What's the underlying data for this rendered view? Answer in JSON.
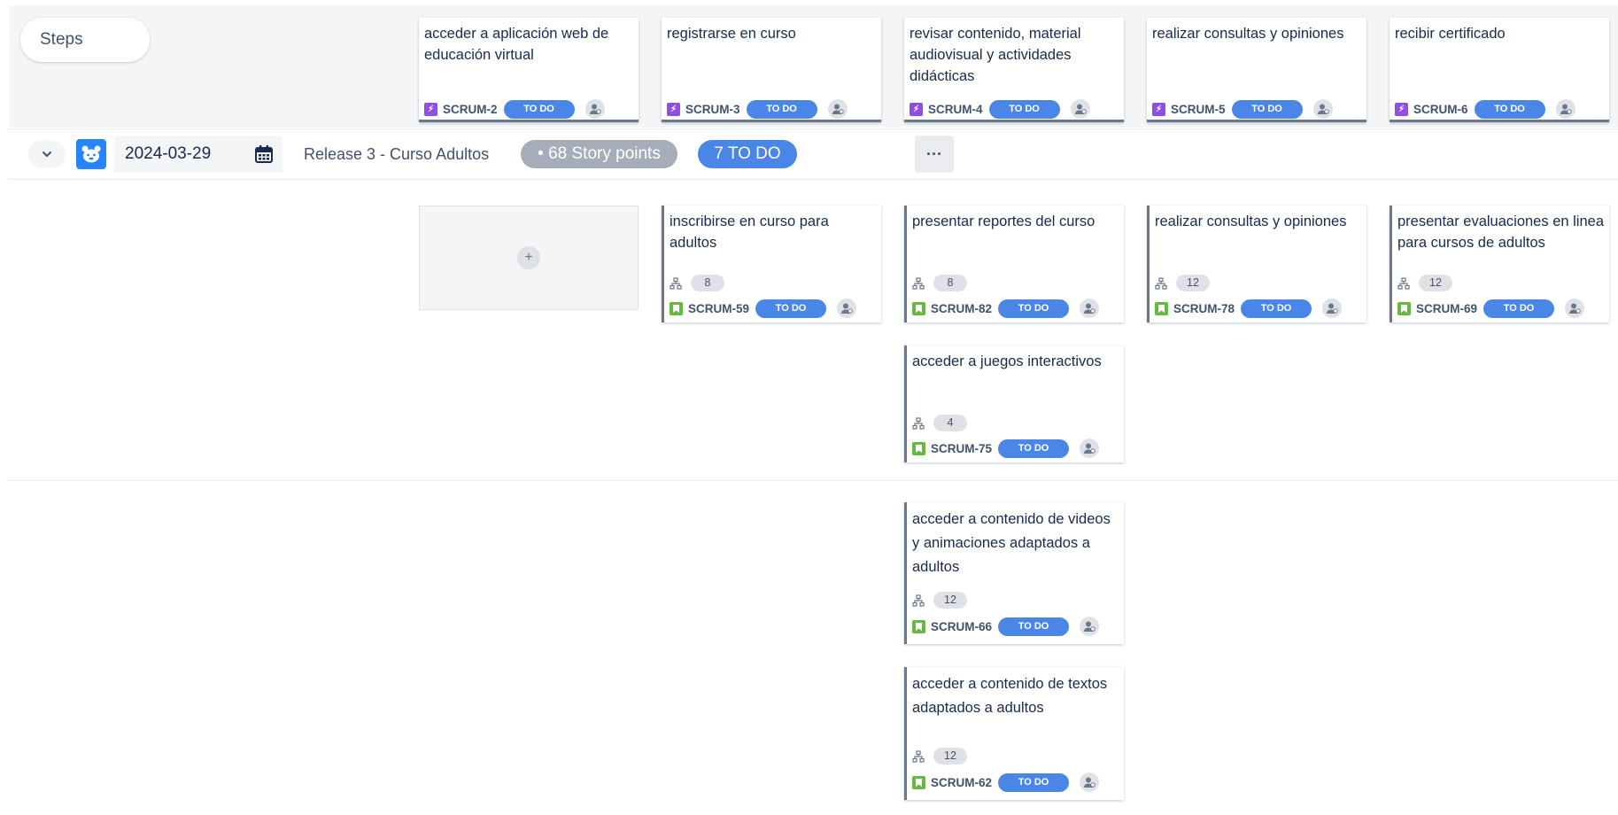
{
  "steps_label": "Steps",
  "epics": [
    {
      "title": "acceder a aplicación web de educación virtual",
      "key": "SCRUM-2",
      "status": "TO DO"
    },
    {
      "title": "registrarse en curso",
      "key": "SCRUM-3",
      "status": "TO DO"
    },
    {
      "title": "revisar contenido, material audiovisual y actividades didácticas",
      "key": "SCRUM-4",
      "status": "TO DO"
    },
    {
      "title": "realizar consultas y opiniones",
      "key": "SCRUM-5",
      "status": "TO DO"
    },
    {
      "title": "recibir certificado",
      "key": "SCRUM-6",
      "status": "TO DO"
    }
  ],
  "release": {
    "date": "2024-03-29",
    "name": "Release 3 - Curso Adultos",
    "story_points": "• 68 Story points",
    "todo": "7 TO DO",
    "more": "···"
  },
  "add_symbol": "+",
  "stories": [
    {
      "title": "inscribirse en curso para adultos",
      "points": "8",
      "key": "SCRUM-59",
      "status": "TO DO"
    },
    {
      "title": "presentar reportes del curso",
      "points": "8",
      "key": "SCRUM-82",
      "status": "TO DO"
    },
    {
      "title": "realizar consultas y opiniones",
      "points": "12",
      "key": "SCRUM-78",
      "status": "TO DO"
    },
    {
      "title": "presentar evaluaciones en linea para cursos de adultos",
      "points": "12",
      "key": "SCRUM-69",
      "status": "TO DO"
    },
    {
      "title": "acceder a juegos interactivos",
      "points": "4",
      "key": "SCRUM-75",
      "status": "TO DO"
    },
    {
      "title": "acceder a contenido de videos y animaciones adaptados a adultos",
      "points": "12",
      "key": "SCRUM-66",
      "status": "TO DO"
    },
    {
      "title": "acceder a contenido de textos adaptados a adultos",
      "points": "12",
      "key": "SCRUM-62",
      "status": "TO DO"
    }
  ],
  "colors": {
    "status_blue": "#4a86e8",
    "epic_purple": "#904ee2",
    "story_green": "#63ba3c",
    "release_blue": "#2684ff",
    "points_gray": "#a5adba"
  },
  "icons": {
    "epic": "lightning-icon",
    "story": "bookmark-icon",
    "assignee": "unassigned-user-icon",
    "calendar": "calendar-icon",
    "collapse": "chevron-down-icon",
    "hierarchy": "hierarchy-icon",
    "more": "more-icon",
    "add": "plus-icon"
  }
}
